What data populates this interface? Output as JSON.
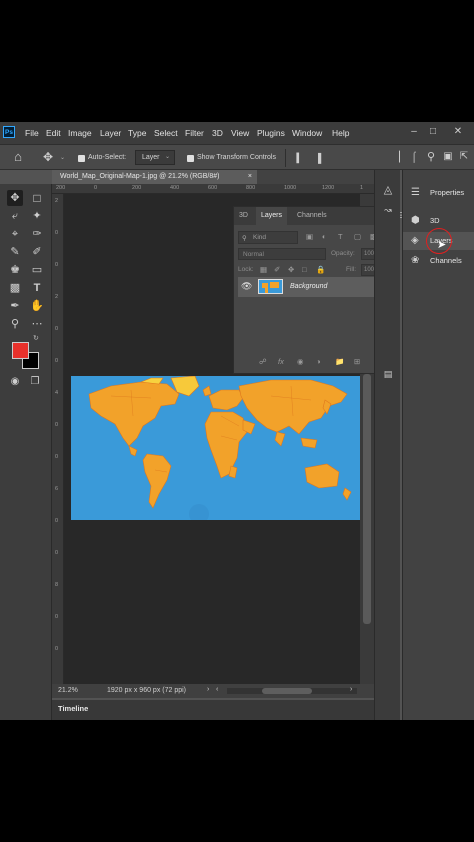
{
  "menubar": {
    "logo": "Ps",
    "items": [
      "File",
      "Edit",
      "Image",
      "Layer",
      "Type",
      "Select",
      "Filter",
      "3D",
      "View",
      "Plugins",
      "Window",
      "Help"
    ],
    "window_controls": [
      "minimize-icon",
      "maximize-icon",
      "close-icon"
    ]
  },
  "options_bar": {
    "auto_select_label": "Auto-Select:",
    "auto_select_value": "Layer",
    "show_transform_label": "Show Transform Controls"
  },
  "document": {
    "tab_title": "World_Map_Original-Map-1.jpg @ 21.2% (RGB/8#)",
    "zoom": "21.2%",
    "dimensions": "1920 px x 960 px (72 ppi)",
    "ruler_h_ticks": [
      "200",
      "0",
      "200",
      "400",
      "600",
      "800",
      "1000",
      "1200",
      "1"
    ],
    "ruler_v_ticks": [
      "2",
      "0",
      "0",
      "2",
      "0",
      "0",
      "4",
      "0",
      "0",
      "6",
      "0",
      "0",
      "8",
      "0",
      "0"
    ]
  },
  "layers_panel": {
    "tabs": [
      "3D",
      "Layers",
      "Channels"
    ],
    "active_tab": "Layers",
    "filter_kind": "Kind",
    "blend_mode": "Normal",
    "opacity_label": "Opacity:",
    "opacity_value": "100%",
    "lock_label": "Lock:",
    "fill_label": "Fill:",
    "fill_value": "100%",
    "layers": [
      {
        "name": "Background",
        "visible": true,
        "locked": true
      }
    ]
  },
  "right_panel": {
    "items": [
      {
        "label": "Properties",
        "icon": "sliders-icon"
      },
      {
        "label": "3D",
        "icon": "cube-icon"
      },
      {
        "label": "Layers",
        "icon": "layers-icon"
      },
      {
        "label": "Channels",
        "icon": "channels-icon"
      }
    ]
  },
  "timeline": {
    "label": "Timeline"
  },
  "colors": {
    "foreground": "#e8312b",
    "background": "#000000",
    "map_ocean": "#3a9ad9",
    "map_land": "#f2a22a",
    "highlight_circle": "#e02020"
  }
}
